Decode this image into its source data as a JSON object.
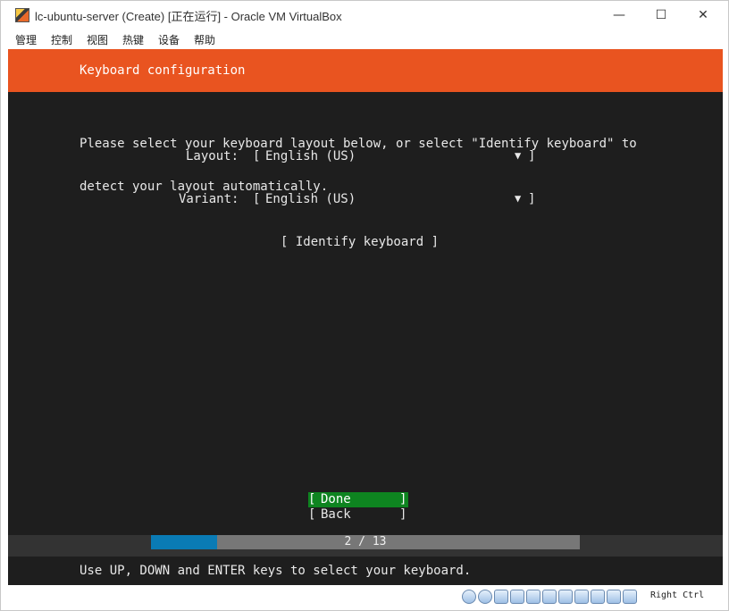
{
  "window": {
    "title": "lc-ubuntu-server (Create) [正在运行] - Oracle VM VirtualBox",
    "minimize_glyph": "—",
    "maximize_glyph": "☐",
    "close_glyph": "✕"
  },
  "menubar": {
    "items": [
      "管理",
      "控制",
      "视图",
      "热键",
      "设备",
      "帮助"
    ]
  },
  "installer": {
    "header_title": "Keyboard configuration",
    "instructions_line1": "Please select your keyboard layout below, or select \"Identify keyboard\" to",
    "instructions_line2": "detect your layout automatically.",
    "layout_label": "Layout:",
    "layout_value": "English (US)",
    "variant_label": "Variant:",
    "variant_value": "English (US)",
    "bracket_open": "[",
    "bracket_close": "]",
    "dropdown_arrow": "▼",
    "identify_button": "[ Identify keyboard ]",
    "done_label": "Done",
    "back_label": "Back",
    "progress_text": "2 / 13",
    "progress_fraction": 0.154,
    "help_text": "Use UP, DOWN and ENTER keys to select your keyboard."
  },
  "statusbar": {
    "tray_icons": [
      "hard-disk-icon",
      "optical-drive-icon",
      "audio-icon",
      "network-icon",
      "usb-icon",
      "shared-folder-icon",
      "display-icon",
      "recording-icon",
      "cpu-icon",
      "mouse-integration-icon",
      "keyboard-icon"
    ],
    "host_key": "Right Ctrl"
  },
  "colors": {
    "ubuntu_orange": "#e95420",
    "done_green": "#0e8420",
    "progress_blue": "#0a7bb5",
    "screen_bg": "#1e1e1e"
  }
}
